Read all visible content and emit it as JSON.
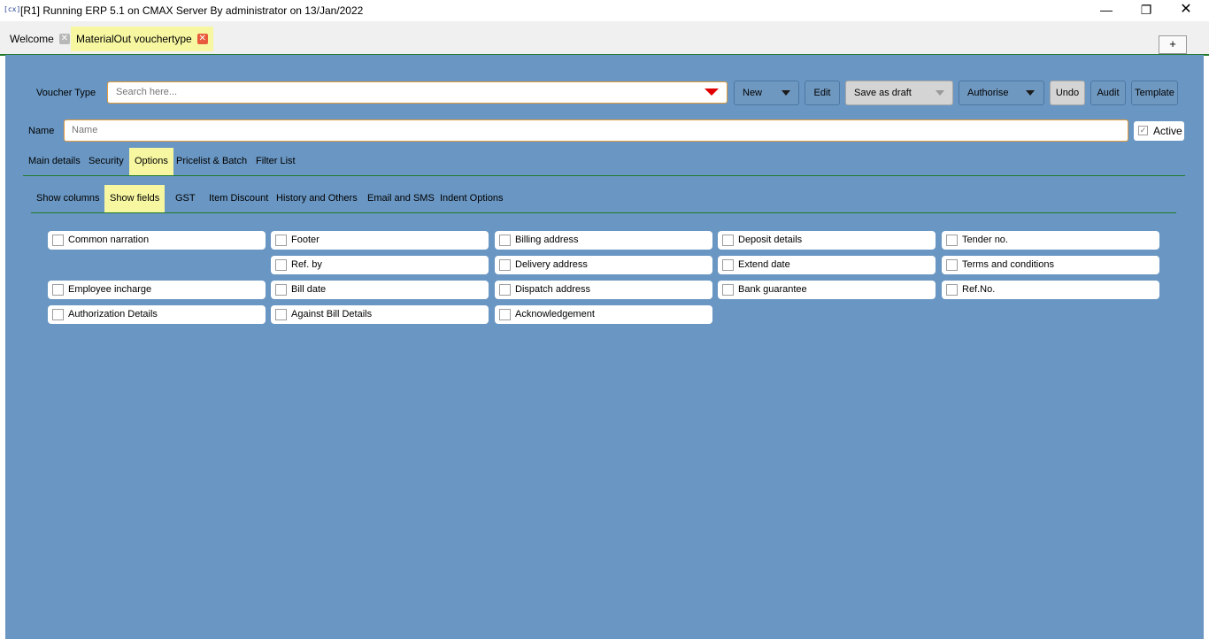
{
  "window": {
    "app_icon": "[cx]",
    "title": "[R1] Running ERP 5.1 on CMAX Server By administrator on 13/Jan/2022",
    "minimize": "—",
    "maximize": "❐",
    "close": "✕"
  },
  "doc_tabs": [
    {
      "label": "Welcome",
      "close": "✕"
    },
    {
      "label": "MaterialOut vouchertype",
      "close": "✕"
    }
  ],
  "plus_label": "+",
  "voucher_type": {
    "label": "Voucher Type",
    "placeholder": "Search here..."
  },
  "toolbar": {
    "new": "New",
    "edit": "Edit",
    "save_draft": "Save as draft",
    "authorise": "Authorise",
    "undo": "Undo",
    "audit": "Audit",
    "template": "Template"
  },
  "name_field": {
    "label": "Name",
    "placeholder": "Name"
  },
  "active": {
    "label": "Active",
    "check": "✓"
  },
  "main_tabs": [
    "Main details",
    "Security",
    "Options",
    "Pricelist & Batch",
    "Filter List"
  ],
  "sub_tabs": [
    "Show columns",
    "Show fields",
    "GST",
    "Item Discount",
    "History and Others",
    "Email and SMS",
    "Indent Options"
  ],
  "fields": {
    "col1": [
      "Common narration",
      "Employee incharge",
      "Authorization Details"
    ],
    "col2": [
      "Footer",
      "Ref. by",
      "Bill date",
      "Against Bill Details"
    ],
    "col3": [
      "Billing address",
      "Delivery address",
      "Dispatch address",
      "Acknowledgement"
    ],
    "col4": [
      "Deposit details",
      "Extend date",
      "Bank guarantee"
    ],
    "col5": [
      "Tender no.",
      "Terms and conditions",
      "Ref.No."
    ]
  },
  "colors": {
    "panel_bg": "#6996c2",
    "selected_tab": "#f7f7a2",
    "accent_border": "#e39b3c",
    "divider": "#207a2a",
    "arrow": "#e00000"
  }
}
